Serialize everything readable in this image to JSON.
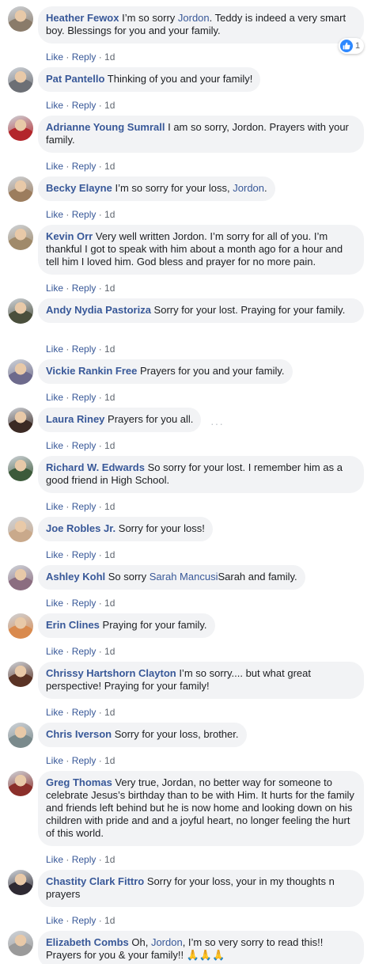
{
  "actions": {
    "like": "Like",
    "reply": "Reply",
    "sep": "·",
    "time": "1d"
  },
  "comments": [
    {
      "author": "Heather Fewox",
      "parts": [
        " I’m so sorry ",
        {
          "mention": "Jordon"
        },
        ". Teddy is indeed a very smart boy. Blessings for you and your family."
      ],
      "reaction_count": "1",
      "avatar_color": "#8a7b6a"
    },
    {
      "author": "Pat Pantello",
      "parts": [
        " Thinking of you and your family!"
      ],
      "avatar_color": "#6c6f75"
    },
    {
      "author": "Adrianne Young Sumrall",
      "parts": [
        " I am so sorry, Jordon. Prayers with your family."
      ],
      "avatar_color": "#b3262b"
    },
    {
      "author": "Becky Elayne",
      "parts": [
        " I’m so sorry for your loss, ",
        {
          "mention": "Jordon"
        },
        "."
      ],
      "avatar_color": "#9c7d5e"
    },
    {
      "author": "Kevin Orr",
      "parts": [
        " Very well written Jordon. I’m sorry for all of you. I’m thankful I got to speak with him about a month ago for a hour and tell him I loved him. God bless and prayer for no more pain."
      ],
      "avatar_color": "#a08a6a"
    },
    {
      "author": "Andy Nydia Pastoriza",
      "parts": [
        " Sorry for your lost. Praying for your family."
      ],
      "avatar_color": "#4a4f3c"
    },
    {
      "author": "Vickie Rankin Free",
      "parts": [
        " Prayers for you and your family."
      ],
      "avatar_color": "#6d6a8c"
    },
    {
      "author": "Laura Riney",
      "parts": [
        " Prayers for you all."
      ],
      "more": "···",
      "avatar_color": "#3b2a24"
    },
    {
      "author": "Richard W. Edwards",
      "parts": [
        " So sorry for your lost. I remember him as a good friend in High School."
      ],
      "avatar_color": "#3c5a3a"
    },
    {
      "author": "Joe Robles Jr.",
      "parts": [
        " Sorry for your loss!"
      ],
      "avatar_color": "#c9a98b"
    },
    {
      "author": "Ashley Kohl",
      "parts": [
        " So sorry ",
        {
          "mention": "Sarah Mancusi"
        },
        "Sarah and family."
      ],
      "avatar_color": "#8b6d80"
    },
    {
      "author": "Erin Clines",
      "parts": [
        " Praying for your family."
      ],
      "avatar_color": "#d98a4e"
    },
    {
      "author": "Chrissy Hartshorn Clayton",
      "parts": [
        " I’m so sorry.... but what great perspective! Praying for your family!"
      ],
      "avatar_color": "#5a3325"
    },
    {
      "author": "Chris Iverson",
      "parts": [
        " Sorry for your loss, brother."
      ],
      "avatar_color": "#7a8a8c"
    },
    {
      "author": "Greg Thomas",
      "parts": [
        " Very true, Jordan, no better way for someone to celebrate Jesus’s birthday than to be with Him. It hurts for the family and friends left behind but he is now home and looking down on his children with pride and and a joyful heart, no longer feeling the hurt of this world."
      ],
      "avatar_color": "#8b2f2a"
    },
    {
      "author": "Chastity Clark Fittro",
      "parts": [
        " Sorry for your loss, your in my thoughts n prayers"
      ],
      "avatar_color": "#2e2a33"
    },
    {
      "author": "Elizabeth Combs",
      "parts": [
        " Oh, ",
        {
          "mention": "Jordon"
        },
        ", I’m so very sorry to read this!! Prayers for you & your family!! ",
        {
          "emoji": "🙏🙏🙏"
        }
      ],
      "avatar_color": "#9a9a9a"
    }
  ]
}
